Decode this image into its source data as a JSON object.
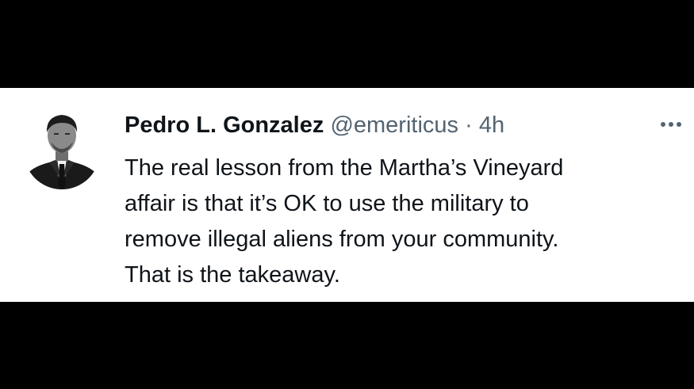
{
  "tweet": {
    "author": {
      "display_name": "Pedro L. Gonzalez",
      "handle": "@emeriticus",
      "avatar_icon": "profile-photo"
    },
    "separator": "·",
    "timestamp": "4h",
    "text_lines": [
      "The real lesson from the Martha’s Vineyard",
      "affair is that it’s OK to use the military to",
      "remove illegal aliens from your community.",
      "That is the takeaway."
    ],
    "more_icon": "more-horizontal-icon"
  },
  "colors": {
    "background": "#000000",
    "card": "#ffffff",
    "primary_text": "#0f1419",
    "secondary_text": "#536471"
  }
}
